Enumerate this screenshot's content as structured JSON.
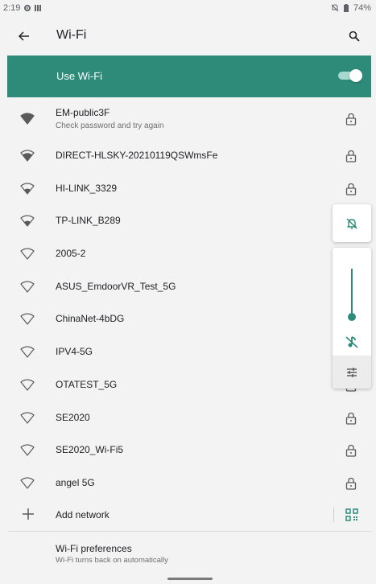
{
  "status_bar": {
    "time": "2:19",
    "battery": "74%",
    "icons": [
      "gear-icon",
      "sim-icon",
      "mute-icon",
      "battery-icon"
    ]
  },
  "app_bar": {
    "title": "Wi-Fi",
    "back_icon": "arrow-back-icon",
    "search_icon": "search-icon"
  },
  "wifi_toggle": {
    "label": "Use Wi-Fi",
    "enabled": true,
    "accent_color": "#2e8b7a"
  },
  "networks": [
    {
      "name": "EM-public3F",
      "status": "Check password and try again",
      "signal": "strong",
      "locked": true
    },
    {
      "name": "DIRECT-HLSKY-20210119QSWmsFe",
      "status": "",
      "signal": "strong",
      "locked": true
    },
    {
      "name": "HI-LINK_3329",
      "status": "",
      "signal": "medium",
      "locked": true
    },
    {
      "name": "TP-LINK_B289",
      "status": "",
      "signal": "medium",
      "locked": true
    },
    {
      "name": "2005-2",
      "status": "",
      "signal": "weak",
      "locked": true
    },
    {
      "name": "ASUS_EmdoorVR_Test_5G",
      "status": "",
      "signal": "weak",
      "locked": true
    },
    {
      "name": "ChinaNet-4bDG",
      "status": "",
      "signal": "weak",
      "locked": true
    },
    {
      "name": "IPV4-5G",
      "status": "",
      "signal": "weak",
      "locked": true
    },
    {
      "name": "OTATEST_5G",
      "status": "",
      "signal": "weak",
      "locked": true
    },
    {
      "name": "SE2020",
      "status": "",
      "signal": "weak",
      "locked": true
    },
    {
      "name": "SE2020_Wi-Fi5",
      "status": "",
      "signal": "weak",
      "locked": true
    },
    {
      "name": "angel 5G",
      "status": "",
      "signal": "weak",
      "locked": true
    }
  ],
  "add_network": {
    "label": "Add network",
    "icon": "plus-icon",
    "qr_icon": "qr-code-scan-icon"
  },
  "preferences": {
    "title": "Wi-Fi preferences",
    "subtitle": "Wi-Fi turns back on automatically"
  },
  "volume_panel": {
    "ringer_icon": "ringer-muted-icon",
    "media_icon": "media-muted-icon",
    "settings_icon": "sliders-icon",
    "level": 0
  }
}
